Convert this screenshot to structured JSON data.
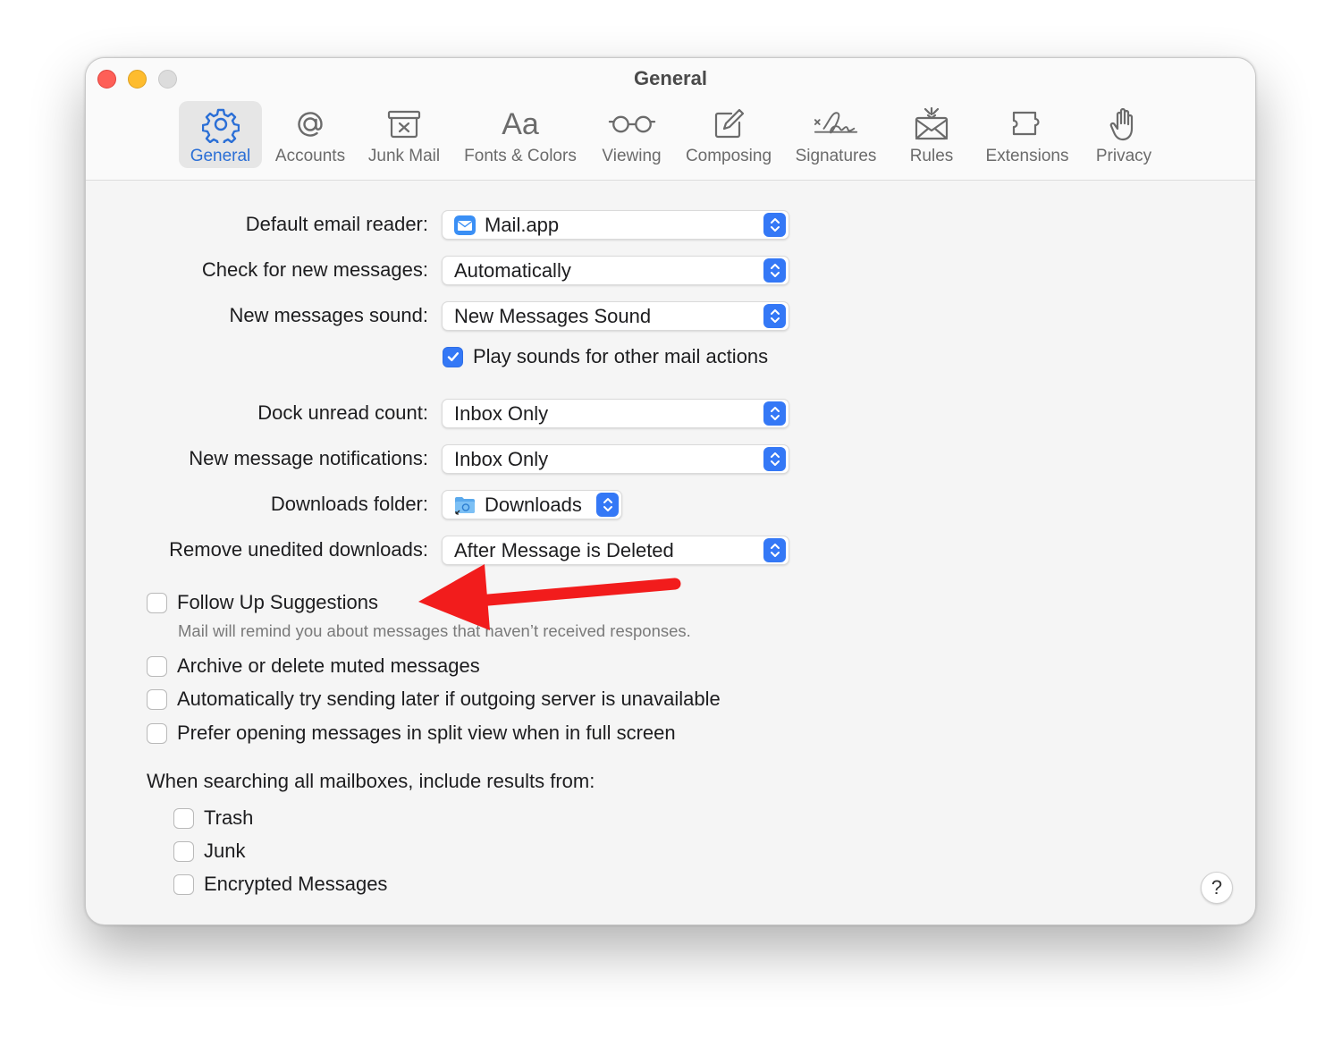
{
  "window": {
    "title": "General"
  },
  "toolbar": {
    "tabs": [
      {
        "label": "General",
        "icon": "gear-icon",
        "selected": true
      },
      {
        "label": "Accounts",
        "icon": "at-sign-icon",
        "selected": false
      },
      {
        "label": "Junk Mail",
        "icon": "junk-bin-icon",
        "selected": false
      },
      {
        "label": "Fonts & Colors",
        "icon": "font-aa-icon",
        "selected": false
      },
      {
        "label": "Viewing",
        "icon": "glasses-icon",
        "selected": false
      },
      {
        "label": "Composing",
        "icon": "compose-icon",
        "selected": false
      },
      {
        "label": "Signatures",
        "icon": "signature-icon",
        "selected": false
      },
      {
        "label": "Rules",
        "icon": "rules-envelope-icon",
        "selected": false
      },
      {
        "label": "Extensions",
        "icon": "puzzle-icon",
        "selected": false
      },
      {
        "label": "Privacy",
        "icon": "hand-icon",
        "selected": false
      }
    ]
  },
  "settings": {
    "default_reader": {
      "label": "Default email reader:",
      "value": "Mail.app",
      "icon": "mail-app-icon"
    },
    "check_new": {
      "label": "Check for new messages:",
      "value": "Automatically"
    },
    "sound": {
      "label": "New messages sound:",
      "value": "New Messages Sound"
    },
    "play_sounds": {
      "label": "Play sounds for other mail actions",
      "checked": true
    },
    "dock_unread": {
      "label": "Dock unread count:",
      "value": "Inbox Only"
    },
    "notifications": {
      "label": "New message notifications:",
      "value": "Inbox Only"
    },
    "downloads_folder": {
      "label": "Downloads folder:",
      "value": "Downloads",
      "icon": "downloads-folder-icon"
    },
    "remove_downloads": {
      "label": "Remove unedited downloads:",
      "value": "After Message is Deleted"
    }
  },
  "options": {
    "follow_up": {
      "label": "Follow Up Suggestions",
      "hint": "Mail will remind you about messages that haven’t received responses.",
      "checked": false
    },
    "archive_muted": {
      "label": "Archive or delete muted messages",
      "checked": false
    },
    "send_later": {
      "label": "Automatically try sending later if outgoing server is unavailable",
      "checked": false
    },
    "split_view": {
      "label": "Prefer opening messages in split view when in full screen",
      "checked": false
    }
  },
  "search": {
    "heading": "When searching all mailboxes, include results from:",
    "trash": {
      "label": "Trash",
      "checked": false
    },
    "junk": {
      "label": "Junk",
      "checked": false
    },
    "encrypted": {
      "label": "Encrypted Messages",
      "checked": false
    }
  },
  "help": {
    "label": "?"
  },
  "colors": {
    "accent": "#3478f6",
    "selected_tab_text": "#2b6fd6",
    "annotation_arrow": "#f21c1c"
  }
}
